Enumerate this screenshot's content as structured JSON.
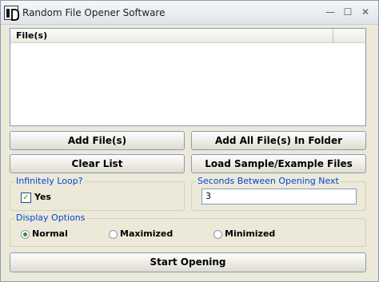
{
  "window": {
    "title": "Random File Opener Software",
    "minimize_glyph": "—",
    "maximize_glyph": "☐",
    "close_glyph": "✕"
  },
  "file_list": {
    "column_header": "File(s)",
    "rows": []
  },
  "buttons": {
    "add_files": "Add File(s)",
    "add_all_files": "Add All File(s) In Folder",
    "clear_list": "Clear List",
    "load_sample": "Load Sample/Example Files",
    "start_opening": "Start Opening"
  },
  "infinitely_loop": {
    "label": "Infinitely Loop?",
    "checkbox_label": "Yes",
    "checked": true,
    "check_glyph": "✓"
  },
  "seconds_between": {
    "label": "Seconds Between Opening Next",
    "value": "3"
  },
  "display_options": {
    "label": "Display Options",
    "options": [
      "Normal",
      "Maximized",
      "Minimized"
    ],
    "selected": "Normal"
  },
  "icons": {
    "app_icon": "app-icon",
    "checkbox": "checkbox-checked-icon"
  }
}
